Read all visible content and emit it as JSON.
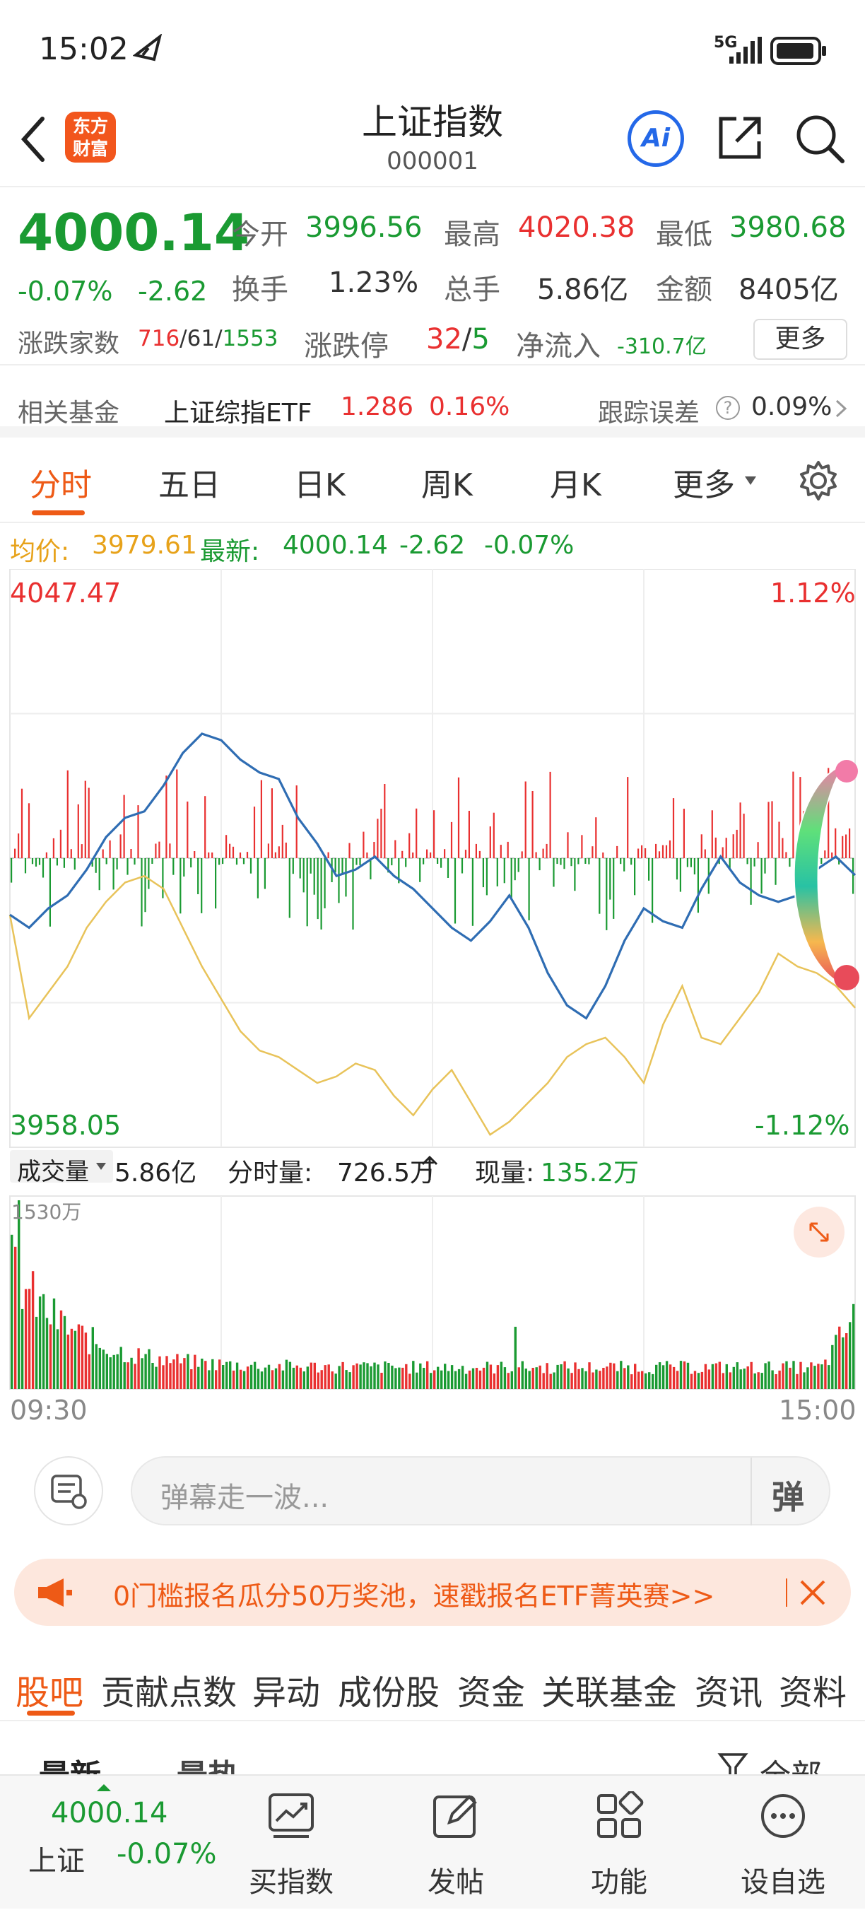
{
  "status_bar": {
    "time": "15:02",
    "network": "5G"
  },
  "nav": {
    "back_icon": "chevron-left-icon",
    "logo_line1": "东方",
    "logo_line2": "财富",
    "title": "上证指数",
    "code": "000001",
    "ai_label": "Ai"
  },
  "quote": {
    "price": "4000.14",
    "change_pct": "-0.07%",
    "change": "-2.62",
    "open_label": "今开",
    "open": "3996.56",
    "high_label": "最高",
    "high": "4020.38",
    "low_label": "最低",
    "low": "3980.68",
    "turnover_label": "换手",
    "turnover": "1.23%",
    "volume_label": "总手",
    "volume": "5.86亿",
    "amount_label": "金额",
    "amount": "8405亿",
    "breadth_label": "涨跌家数",
    "breadth_up": "716",
    "breadth_flat": "61",
    "breadth_down": "1553",
    "limit_label": "涨跌停",
    "limit_up": "32",
    "limit_down": "5",
    "inflow_label": "净流入",
    "inflow": "-310.7亿",
    "more_button": "更多"
  },
  "related_fund": {
    "label": "相关基金",
    "name": "上证综指ETF",
    "price": "1.286",
    "pct": "0.16%",
    "tracking_label": "跟踪误差",
    "tracking_value": "0.09%"
  },
  "chart_tabs": [
    "分时",
    "五日",
    "日K",
    "周K",
    "月K",
    "更多"
  ],
  "chart_info": {
    "avg_label": "均价:",
    "avg_value": "3979.61",
    "latest_label": "最新:",
    "latest_value": "4000.14",
    "latest_change": "-2.62",
    "latest_pct": "-0.07%"
  },
  "price_axis": {
    "top_price": "4047.47",
    "top_pct": "1.12%",
    "bottom_price": "3958.05",
    "bottom_pct": "-1.12%"
  },
  "volume_info": {
    "selector": "成交量",
    "total": "5.86亿",
    "minute_label": "分时量:",
    "minute_value": "726.5万",
    "now_label": "现量:",
    "now_value": "135.2万",
    "max_label": "1530万",
    "time_start": "09:30",
    "time_end": "15:00"
  },
  "colors": {
    "up": "#e93030",
    "down": "#1a9a32",
    "price_line": "#2f6db3",
    "avg_line": "#e8c35a",
    "accent": "#ee5a16"
  },
  "chart_data": {
    "type": "line",
    "x_range": [
      "09:30",
      "15:00"
    ],
    "ylim": [
      3958.05,
      4047.47
    ],
    "prev_close": 4002.76,
    "series": [
      {
        "values": [
          3994,
          3992,
          3995,
          3997,
          4001,
          4006,
          4009,
          4010,
          4014,
          4019,
          4022,
          4021,
          4018,
          4016,
          4015,
          4009,
          4005,
          4000,
          4001,
          4003,
          4000,
          3998,
          3995,
          3992,
          3990,
          3993,
          3997,
          3992,
          3985,
          3980,
          3978,
          3983,
          3990,
          3995,
          3993,
          3992,
          3998,
          4003,
          3999,
          3997,
          3996,
          3997,
          4001,
          4003,
          4000.14
        ]
      },
      {
        "values": [
          3994,
          3978,
          3982,
          3986,
          3992,
          3996,
          3999,
          4000,
          3998,
          3992,
          3986,
          3981,
          3976,
          3973,
          3972,
          3970,
          3968,
          3969,
          3971,
          3970,
          3966,
          3963,
          3967,
          3970,
          3965,
          3960,
          3962,
          3965,
          3968,
          3972,
          3974,
          3975,
          3972,
          3968,
          3977,
          3983,
          3975,
          3974,
          3978,
          3982,
          3988,
          3986,
          3985,
          3983,
          3979.61
        ]
      }
    ]
  },
  "comment": {
    "placeholder": "弹幕走一波...",
    "danmu_label": "弹"
  },
  "banner": {
    "text": "0门槛报名瓜分50万奖池，速戳报名ETF菁英赛>>"
  },
  "bottom_tabs": [
    "股吧",
    "贡献点数",
    "异动",
    "成份股",
    "资金",
    "关联基金",
    "资讯",
    "资料"
  ],
  "sort_row": {
    "latest": "最新",
    "hot": "最热",
    "filter": "全部"
  },
  "bottom_bar": {
    "price": "4000.14",
    "name": "上证",
    "pct": "-0.07%",
    "buttons": [
      "买指数",
      "发帖",
      "功能",
      "设自选"
    ]
  }
}
